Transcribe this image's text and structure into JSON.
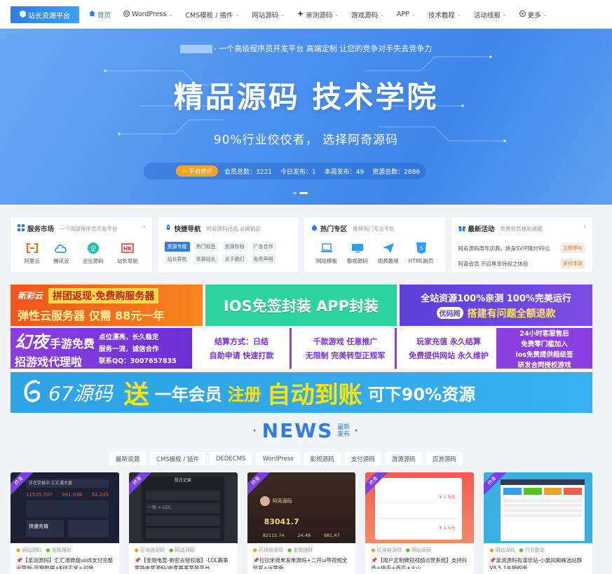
{
  "nav": {
    "logo": "站长资源平台",
    "items": [
      {
        "label": "首页",
        "caret": ""
      },
      {
        "label": "WordPress",
        "caret": "⌄"
      },
      {
        "label": "CMS模板 / 插件",
        "caret": "⌄"
      },
      {
        "label": "网站源码",
        "caret": "⌄"
      },
      {
        "label": "亲测源码",
        "caret": "⌄"
      },
      {
        "label": "游戏源码",
        "caret": "⌄"
      },
      {
        "label": "APP",
        "caret": "⌄"
      },
      {
        "label": "技术教程",
        "caret": "⌄"
      },
      {
        "label": "活动线报",
        "caret": "⌄"
      },
      {
        "label": "更多",
        "caret": "⌄"
      }
    ]
  },
  "hero": {
    "tagline": "- 一个高级程序员开发平台 高端定制 让您的竞争对手失去竞争力",
    "title": "精品源码 技术学院",
    "subtitle": "90%行业佼佼者， 选择阿奇源码",
    "stats_pill": "平台统计",
    "stats": [
      {
        "label": "会员总数：",
        "value": "3221"
      },
      {
        "label": "今日发布：",
        "value": "1"
      },
      {
        "label": "本周发布：",
        "value": "49"
      },
      {
        "label": "资源总数：",
        "value": "2886"
      }
    ]
  },
  "cards": [
    {
      "title": "服务市场",
      "sub": "一个高级程序员开发平台",
      "icons": [
        "阿里云",
        "腾讯云",
        "企业源码",
        "站长导航"
      ]
    },
    {
      "title": "快捷导航",
      "sub": "阿奇源码出品 必属精品",
      "tags": [
        "资源专题",
        "热门标签",
        "资源存档",
        "广告合作",
        "站长导航",
        "资源站长",
        "关于我们",
        "免责声明"
      ]
    },
    {
      "title": "热门专区",
      "sub": "推荐热门专业专区",
      "icons": [
        "网站模板",
        "影视源码",
        "视频教程",
        "HTML网页"
      ]
    },
    {
      "title": "最新活动",
      "sub": "免费会员福利福报",
      "acts": [
        {
          "text": "阿奇源码周年庆典，终身SVIP限时99元",
          "btn": "立即参与"
        },
        {
          "text": "阿奇会员 开启尊享特权之体验",
          "btn": "支付本站"
        }
      ]
    }
  ],
  "ads": {
    "a1_top": "新彩云",
    "a1_mid": "拼团返现·免费购服务器",
    "a1_bot": "弹性云服务器 仅需 88元一年",
    "a2": "IOS免签封装  APP封装",
    "a3_top": "全站资源100%亲测 100%完美运行",
    "a3_logo": "优码网",
    "a3_bot": "搭建有问题全额退款",
    "b1_big": "幻夜",
    "b1_mid": "手游免费",
    "b1_bot": "招游戏代理啦",
    "b1_r1": "点位漂亮，长久稳定",
    "b1_r2": "服务一流，诚信合作",
    "b1_r3": "联系QQ：3007657835",
    "b2_l1": "结算方式：日结",
    "b2_l2": "自助申请  快速打款",
    "b2_m1": "千款游戏  任意推广",
    "b2_m2": "无限制  完美转型正规军",
    "b2_r1": "玩家充值  永久结算",
    "b2_r2": "免费提供网站  永久维护",
    "b2_x1": "24小时客服售后",
    "b2_x2": "免费零门槛加入",
    "b2_x3": "ios免费提供超级签",
    "b2_x4": "研发合同授权游戏",
    "c_brand": "67源码",
    "c_a": "送",
    "c_b": "一年会员",
    "c_c": "注册",
    "c_d": "自动到账",
    "c_e": "可下90%资源"
  },
  "news": {
    "title": "NEWS",
    "small1": "最新",
    "small2": "发布",
    "tabs": [
      "最新资源",
      "CMS模板 / 插件",
      "DEDECMS",
      "WordPress",
      "影视源码",
      "支付源码",
      "游源源码",
      "页游源码"
    ]
  },
  "posts": [
    {
      "ribbon": "终身",
      "cat1": "网站源码",
      "cat2": "金融理财",
      "title": "【亲测源码】汇汇通微盘usdt支付完整运营版-完整数据+K线正常+对接"
    },
    {
      "ribbon": "终身",
      "cat1": "区块链源码",
      "cat2": "网站源码",
      "title": "【金刚电竞-新密去授权版】-LOL赛事竞猜电竞源码/电竞赛事竞猜平台"
    },
    {
      "ribbon": "终身",
      "cat1": "区块链源码",
      "cat2": "金融理财",
      "title": "拉拉米抢单发单源码+二开ui带视频全修复+运营版"
    },
    {
      "ribbon": "终身",
      "cat1": "区块链源码",
      "cat2": "网站源码",
      "title": "【用户定制做短视频点赞系统】支持抖音+快手+西瓜+火山"
    },
    {
      "ribbon": "终身",
      "cat1": "网站源码",
      "cat2": "行业整站",
      "title": "亲测源码有演示站-小旋风蜘蛛池站群V8.5.1去授权版"
    }
  ],
  "thumbs": {
    "t1_head": "正在交易中 汇汇通大盘",
    "t1_num1": "11535.707",
    "t1_num2": "991.938",
    "t1_num3": "54.205",
    "t1_btn": "快速充值",
    "t2_head": "投注记录",
    "t2_row": "一场 = LGC",
    "t3_name": "阿奇源码",
    "t3_big": "83041.7",
    "t3_n1": "82115.74",
    "t3_n2": "24.49",
    "t3_n3": "981.47",
    "t4_price1": "¥ 1.5元",
    "t4_price2": "¥ 1.5元"
  }
}
